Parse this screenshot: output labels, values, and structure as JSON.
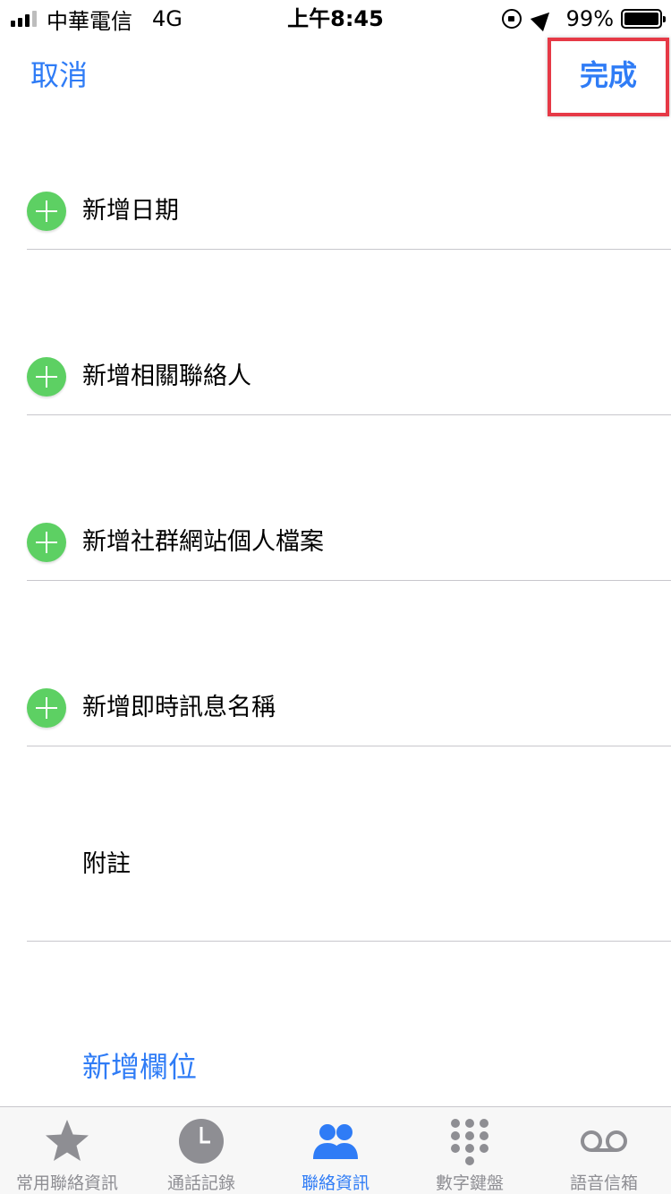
{
  "status_bar": {
    "carrier": "中華電信",
    "network": "4G",
    "time": "上午8:45",
    "battery_percent": "99%"
  },
  "nav": {
    "cancel_label": "取消",
    "done_label": "完成"
  },
  "rows": [
    {
      "label": "新增日期",
      "has_plus": true
    },
    {
      "label": "新增相關聯絡人",
      "has_plus": true
    },
    {
      "label": "新增社群網站個人檔案",
      "has_plus": true
    },
    {
      "label": "新增即時訊息名稱",
      "has_plus": true
    },
    {
      "label": "附註",
      "has_plus": false
    }
  ],
  "add_field_label": "新增欄位",
  "tabs": [
    {
      "label": "常用聯絡資訊",
      "icon": "star-icon",
      "active": false
    },
    {
      "label": "通話記錄",
      "icon": "clock-icon",
      "active": false
    },
    {
      "label": "聯絡資訊",
      "icon": "contacts-icon",
      "active": true
    },
    {
      "label": "數字鍵盤",
      "icon": "keypad-icon",
      "active": false
    },
    {
      "label": "語音信箱",
      "icon": "voicemail-icon",
      "active": false
    }
  ],
  "colors": {
    "accent": "#2f7cf6",
    "plus_green": "#5dd063",
    "highlight": "#e63946",
    "inactive_tab": "#8e8e93"
  }
}
